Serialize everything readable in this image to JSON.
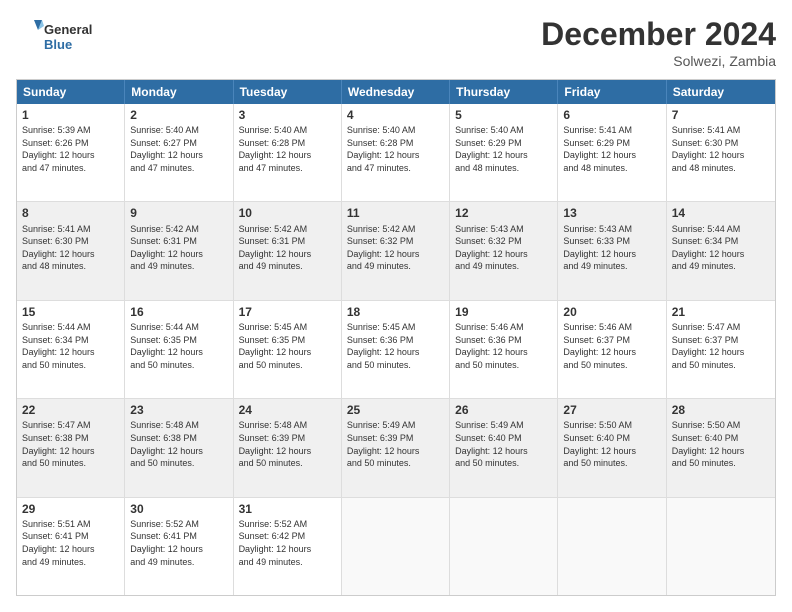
{
  "header": {
    "logo_text_general": "General",
    "logo_text_blue": "Blue",
    "month": "December 2024",
    "location": "Solwezi, Zambia"
  },
  "days_of_week": [
    "Sunday",
    "Monday",
    "Tuesday",
    "Wednesday",
    "Thursday",
    "Friday",
    "Saturday"
  ],
  "weeks": [
    [
      {
        "day": "1",
        "lines": [
          "Sunrise: 5:39 AM",
          "Sunset: 6:26 PM",
          "Daylight: 12 hours",
          "and 47 minutes."
        ]
      },
      {
        "day": "2",
        "lines": [
          "Sunrise: 5:40 AM",
          "Sunset: 6:27 PM",
          "Daylight: 12 hours",
          "and 47 minutes."
        ]
      },
      {
        "day": "3",
        "lines": [
          "Sunrise: 5:40 AM",
          "Sunset: 6:28 PM",
          "Daylight: 12 hours",
          "and 47 minutes."
        ]
      },
      {
        "day": "4",
        "lines": [
          "Sunrise: 5:40 AM",
          "Sunset: 6:28 PM",
          "Daylight: 12 hours",
          "and 47 minutes."
        ]
      },
      {
        "day": "5",
        "lines": [
          "Sunrise: 5:40 AM",
          "Sunset: 6:29 PM",
          "Daylight: 12 hours",
          "and 48 minutes."
        ]
      },
      {
        "day": "6",
        "lines": [
          "Sunrise: 5:41 AM",
          "Sunset: 6:29 PM",
          "Daylight: 12 hours",
          "and 48 minutes."
        ]
      },
      {
        "day": "7",
        "lines": [
          "Sunrise: 5:41 AM",
          "Sunset: 6:30 PM",
          "Daylight: 12 hours",
          "and 48 minutes."
        ]
      }
    ],
    [
      {
        "day": "8",
        "lines": [
          "Sunrise: 5:41 AM",
          "Sunset: 6:30 PM",
          "Daylight: 12 hours",
          "and 48 minutes."
        ]
      },
      {
        "day": "9",
        "lines": [
          "Sunrise: 5:42 AM",
          "Sunset: 6:31 PM",
          "Daylight: 12 hours",
          "and 49 minutes."
        ]
      },
      {
        "day": "10",
        "lines": [
          "Sunrise: 5:42 AM",
          "Sunset: 6:31 PM",
          "Daylight: 12 hours",
          "and 49 minutes."
        ]
      },
      {
        "day": "11",
        "lines": [
          "Sunrise: 5:42 AM",
          "Sunset: 6:32 PM",
          "Daylight: 12 hours",
          "and 49 minutes."
        ]
      },
      {
        "day": "12",
        "lines": [
          "Sunrise: 5:43 AM",
          "Sunset: 6:32 PM",
          "Daylight: 12 hours",
          "and 49 minutes."
        ]
      },
      {
        "day": "13",
        "lines": [
          "Sunrise: 5:43 AM",
          "Sunset: 6:33 PM",
          "Daylight: 12 hours",
          "and 49 minutes."
        ]
      },
      {
        "day": "14",
        "lines": [
          "Sunrise: 5:44 AM",
          "Sunset: 6:34 PM",
          "Daylight: 12 hours",
          "and 49 minutes."
        ]
      }
    ],
    [
      {
        "day": "15",
        "lines": [
          "Sunrise: 5:44 AM",
          "Sunset: 6:34 PM",
          "Daylight: 12 hours",
          "and 50 minutes."
        ]
      },
      {
        "day": "16",
        "lines": [
          "Sunrise: 5:44 AM",
          "Sunset: 6:35 PM",
          "Daylight: 12 hours",
          "and 50 minutes."
        ]
      },
      {
        "day": "17",
        "lines": [
          "Sunrise: 5:45 AM",
          "Sunset: 6:35 PM",
          "Daylight: 12 hours",
          "and 50 minutes."
        ]
      },
      {
        "day": "18",
        "lines": [
          "Sunrise: 5:45 AM",
          "Sunset: 6:36 PM",
          "Daylight: 12 hours",
          "and 50 minutes."
        ]
      },
      {
        "day": "19",
        "lines": [
          "Sunrise: 5:46 AM",
          "Sunset: 6:36 PM",
          "Daylight: 12 hours",
          "and 50 minutes."
        ]
      },
      {
        "day": "20",
        "lines": [
          "Sunrise: 5:46 AM",
          "Sunset: 6:37 PM",
          "Daylight: 12 hours",
          "and 50 minutes."
        ]
      },
      {
        "day": "21",
        "lines": [
          "Sunrise: 5:47 AM",
          "Sunset: 6:37 PM",
          "Daylight: 12 hours",
          "and 50 minutes."
        ]
      }
    ],
    [
      {
        "day": "22",
        "lines": [
          "Sunrise: 5:47 AM",
          "Sunset: 6:38 PM",
          "Daylight: 12 hours",
          "and 50 minutes."
        ]
      },
      {
        "day": "23",
        "lines": [
          "Sunrise: 5:48 AM",
          "Sunset: 6:38 PM",
          "Daylight: 12 hours",
          "and 50 minutes."
        ]
      },
      {
        "day": "24",
        "lines": [
          "Sunrise: 5:48 AM",
          "Sunset: 6:39 PM",
          "Daylight: 12 hours",
          "and 50 minutes."
        ]
      },
      {
        "day": "25",
        "lines": [
          "Sunrise: 5:49 AM",
          "Sunset: 6:39 PM",
          "Daylight: 12 hours",
          "and 50 minutes."
        ]
      },
      {
        "day": "26",
        "lines": [
          "Sunrise: 5:49 AM",
          "Sunset: 6:40 PM",
          "Daylight: 12 hours",
          "and 50 minutes."
        ]
      },
      {
        "day": "27",
        "lines": [
          "Sunrise: 5:50 AM",
          "Sunset: 6:40 PM",
          "Daylight: 12 hours",
          "and 50 minutes."
        ]
      },
      {
        "day": "28",
        "lines": [
          "Sunrise: 5:50 AM",
          "Sunset: 6:40 PM",
          "Daylight: 12 hours",
          "and 50 minutes."
        ]
      }
    ],
    [
      {
        "day": "29",
        "lines": [
          "Sunrise: 5:51 AM",
          "Sunset: 6:41 PM",
          "Daylight: 12 hours",
          "and 49 minutes."
        ]
      },
      {
        "day": "30",
        "lines": [
          "Sunrise: 5:52 AM",
          "Sunset: 6:41 PM",
          "Daylight: 12 hours",
          "and 49 minutes."
        ]
      },
      {
        "day": "31",
        "lines": [
          "Sunrise: 5:52 AM",
          "Sunset: 6:42 PM",
          "Daylight: 12 hours",
          "and 49 minutes."
        ]
      },
      {
        "day": "",
        "lines": []
      },
      {
        "day": "",
        "lines": []
      },
      {
        "day": "",
        "lines": []
      },
      {
        "day": "",
        "lines": []
      }
    ]
  ]
}
